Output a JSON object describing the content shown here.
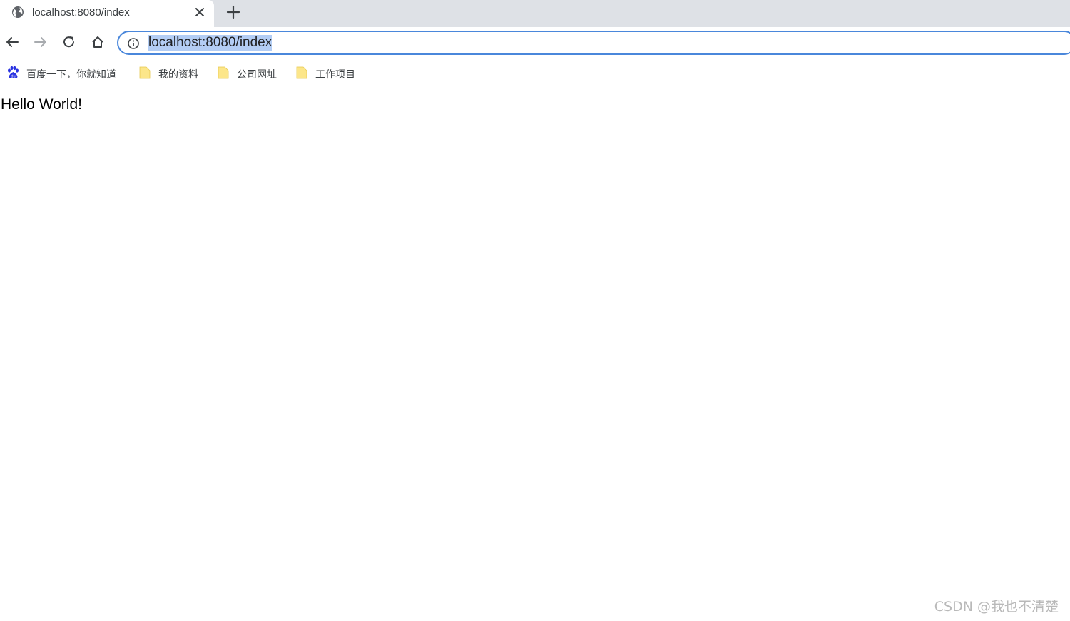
{
  "browser": {
    "tab": {
      "title": "localhost:8080/index",
      "favicon": "globe-icon"
    },
    "address_bar": {
      "url": "localhost:8080/index",
      "security_icon": "info-icon",
      "accent_color": "#4a87db",
      "selection_color": "#b3cdf4"
    },
    "nav_icons": [
      "back-arrow-icon",
      "forward-arrow-icon",
      "reload-icon",
      "home-icon"
    ]
  },
  "bookmarks": [
    {
      "label": "百度一下，你就知道",
      "icon": "baidu-paw-icon"
    },
    {
      "label": "我的资料",
      "icon": "folder-icon"
    },
    {
      "label": "公司网址",
      "icon": "folder-icon"
    },
    {
      "label": "工作项目",
      "icon": "folder-icon"
    }
  ],
  "page": {
    "body_text": "Hello World!"
  },
  "watermark": {
    "text": "CSDN @我也不清楚"
  }
}
